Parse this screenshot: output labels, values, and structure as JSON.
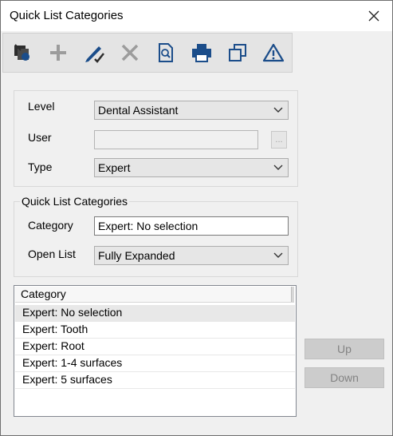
{
  "window": {
    "title": "Quick List Categories"
  },
  "toolbar": {
    "items": [
      {
        "name": "open-icon"
      },
      {
        "name": "add-icon"
      },
      {
        "name": "edit-icon"
      },
      {
        "name": "delete-icon"
      },
      {
        "name": "preview-icon"
      },
      {
        "name": "print-icon"
      },
      {
        "name": "copy-icon"
      },
      {
        "name": "alert-icon"
      }
    ]
  },
  "filters": {
    "level_label": "Level",
    "level_value": "Dental Assistant",
    "user_label": "User",
    "user_value": "",
    "user_browse": "...",
    "type_label": "Type",
    "type_value": "Expert"
  },
  "qlc": {
    "legend": "Quick List Categories",
    "category_label": "Category",
    "category_value": "Expert: No selection",
    "openlist_label": "Open List",
    "openlist_value": "Fully Expanded"
  },
  "list": {
    "header": "Category",
    "rows": [
      "Expert: No selection",
      "Expert: Tooth",
      "Expert: Root",
      "Expert: 1-4 surfaces",
      "Expert: 5 surfaces"
    ],
    "selected_index": 0
  },
  "buttons": {
    "up": "Up",
    "down": "Down"
  },
  "colors": {
    "toolbar_icon": "#2d2d2d",
    "disabled_icon": "#9c9c9c",
    "accent_blue": "#1b4d8a"
  }
}
